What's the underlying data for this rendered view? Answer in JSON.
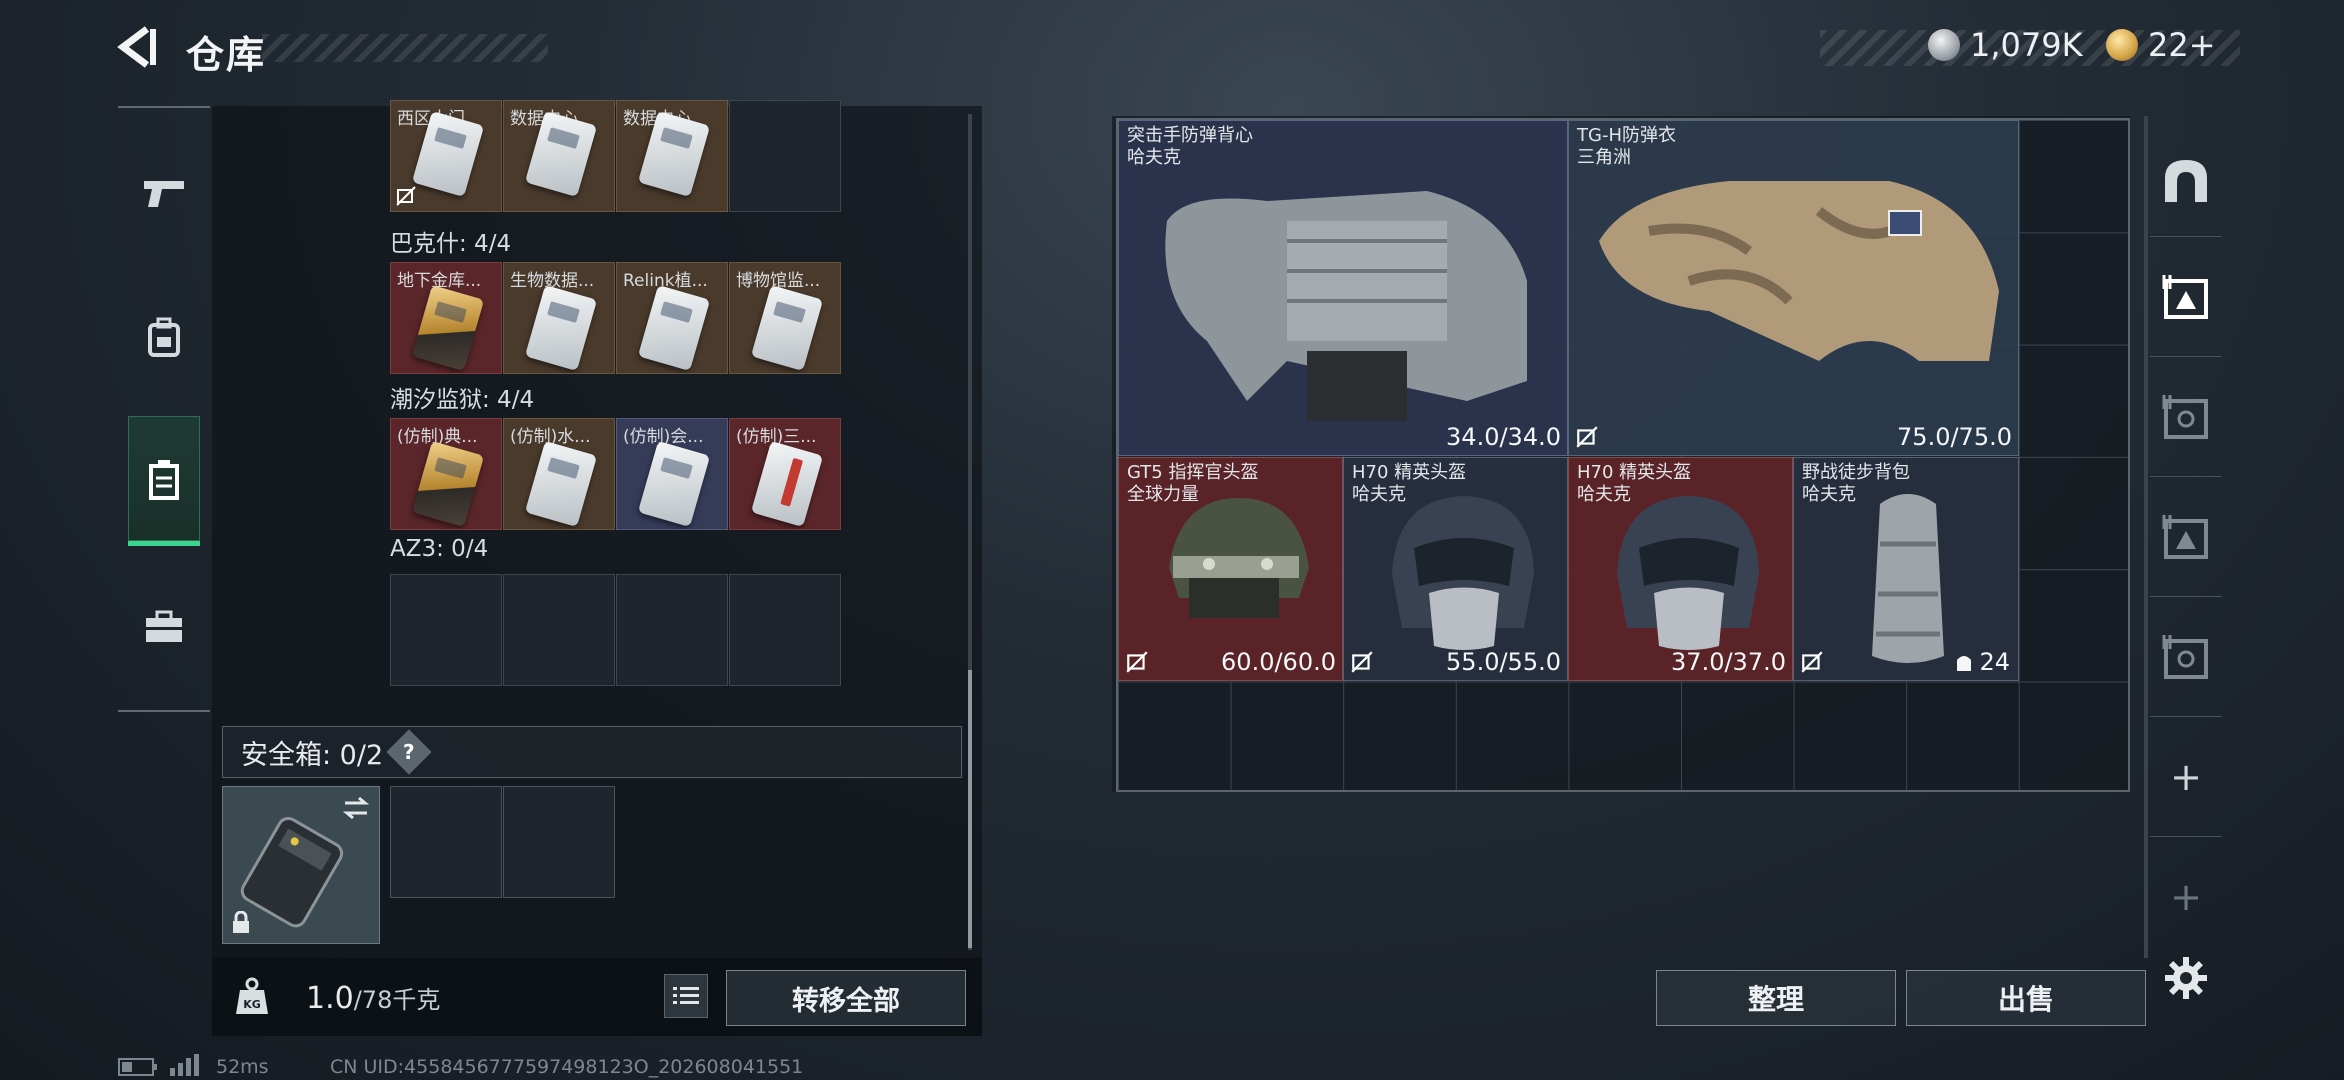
{
  "header": {
    "title": "仓库",
    "currency_primary": "1,079K",
    "currency_secondary": "22+"
  },
  "left_rail": {
    "items": [
      {
        "icon": "pistol-icon"
      },
      {
        "icon": "backpack-icon"
      },
      {
        "icon": "container-icon",
        "active": true
      },
      {
        "icon": "toolbox-icon"
      }
    ]
  },
  "keycards": {
    "top_row": [
      {
        "label": "西区大门",
        "color": "brown",
        "no_trade": true
      },
      {
        "label": "数据中心",
        "color": "brown"
      },
      {
        "label": "数据中心",
        "color": "brown"
      },
      {
        "label": "",
        "color": "empty"
      }
    ],
    "groups": [
      {
        "label": "巴克什: 4/4",
        "cells": [
          {
            "label": "地下金库...",
            "color": "red",
            "card": "gold"
          },
          {
            "label": "生物数据...",
            "color": "brown",
            "card": "white"
          },
          {
            "label": "Relink植...",
            "color": "brown",
            "card": "white"
          },
          {
            "label": "博物馆监...",
            "color": "brown",
            "card": "white"
          }
        ]
      },
      {
        "label": "潮汐监狱: 4/4",
        "cells": [
          {
            "label": "(仿制)典...",
            "color": "red",
            "card": "gold"
          },
          {
            "label": "(仿制)水...",
            "color": "brown",
            "card": "white"
          },
          {
            "label": "(仿制)会...",
            "color": "brown",
            "card": "white"
          },
          {
            "label": "(仿制)三...",
            "color": "red",
            "card": "redband"
          }
        ]
      },
      {
        "label": "AZ3: 0/4",
        "cells": []
      }
    ]
  },
  "safe_box": {
    "label": "安全箱: 0/2",
    "help": "?"
  },
  "weight": {
    "current": "1.0",
    "max": "/78千克",
    "icon_label": "KG"
  },
  "buttons": {
    "transfer_all": "转移全部",
    "sort": "整理",
    "sell": "出售"
  },
  "stash_items": [
    {
      "name": "突击手防弹背心",
      "sub": "哈夫克",
      "durability": "34.0/34.0",
      "color": "navy"
    },
    {
      "name": "TG-H防弹衣",
      "sub": "三角洲",
      "durability": "75.0/75.0",
      "color": "steel"
    },
    {
      "name": "GT5 指挥官头盔",
      "sub": "全球力量",
      "durability": "60.0/60.0",
      "color": "red"
    },
    {
      "name": "H70 精英头盔",
      "sub": "哈夫克",
      "durability": "55.0/55.0",
      "color": "dark"
    },
    {
      "name": "H70 精英头盔",
      "sub": "哈夫克",
      "durability": "37.0/37.0",
      "color": "red"
    },
    {
      "name": "野战徒步背包",
      "sub": "哈夫克",
      "capacity": "24",
      "color": "dark"
    }
  ],
  "footer": {
    "ping": "52ms",
    "uid": "CN UID:4558456777597498123O_202608041551"
  },
  "colors": {
    "accent_green": "#3cd58f",
    "red_rarity": "#5a262a",
    "navy_rarity": "#2c344e"
  }
}
